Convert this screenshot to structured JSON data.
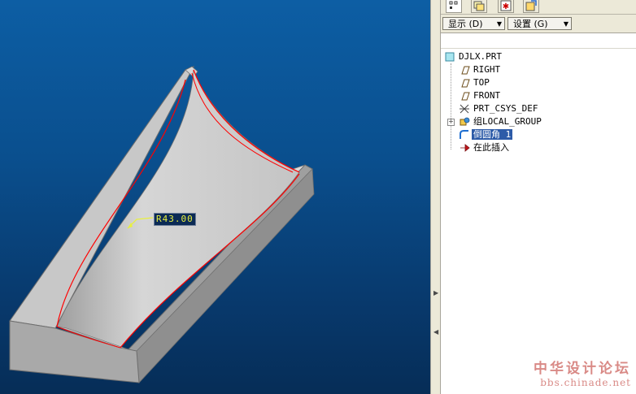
{
  "viewport": {
    "dimension_label": "R43.00",
    "background_top": "#0d5ea4",
    "background_bottom": "#062d57"
  },
  "panel": {
    "tabs": [
      {
        "icon": "model-tree-icon"
      },
      {
        "icon": "layers-icon"
      },
      {
        "icon": "favorites-icon"
      },
      {
        "icon": "connections-icon"
      }
    ],
    "toolbar": {
      "show_label": "显示 (D)",
      "settings_label": "设置 (G)"
    },
    "tree": {
      "root": "DJLX.PRT",
      "items": [
        {
          "label": "RIGHT",
          "icon": "datum-plane-icon"
        },
        {
          "label": "TOP",
          "icon": "datum-plane-icon"
        },
        {
          "label": "FRONT",
          "icon": "datum-plane-icon"
        },
        {
          "label": "PRT_CSYS_DEF",
          "icon": "coordinate-system-icon"
        },
        {
          "label": "组LOCAL_GROUP",
          "icon": "group-icon"
        },
        {
          "label": "倒圆角 1",
          "icon": "round-icon",
          "selected": true
        },
        {
          "label": "在此插入",
          "icon": "insert-here-icon"
        }
      ]
    }
  },
  "watermark": {
    "line1": "中华设计论坛",
    "line2": "bbs.chinade.net"
  },
  "colors": {
    "selection": "#2d5ba8",
    "edge_highlight": "#ff0000",
    "dimension_text": "#e8f040",
    "watermark": "#d98a86"
  }
}
